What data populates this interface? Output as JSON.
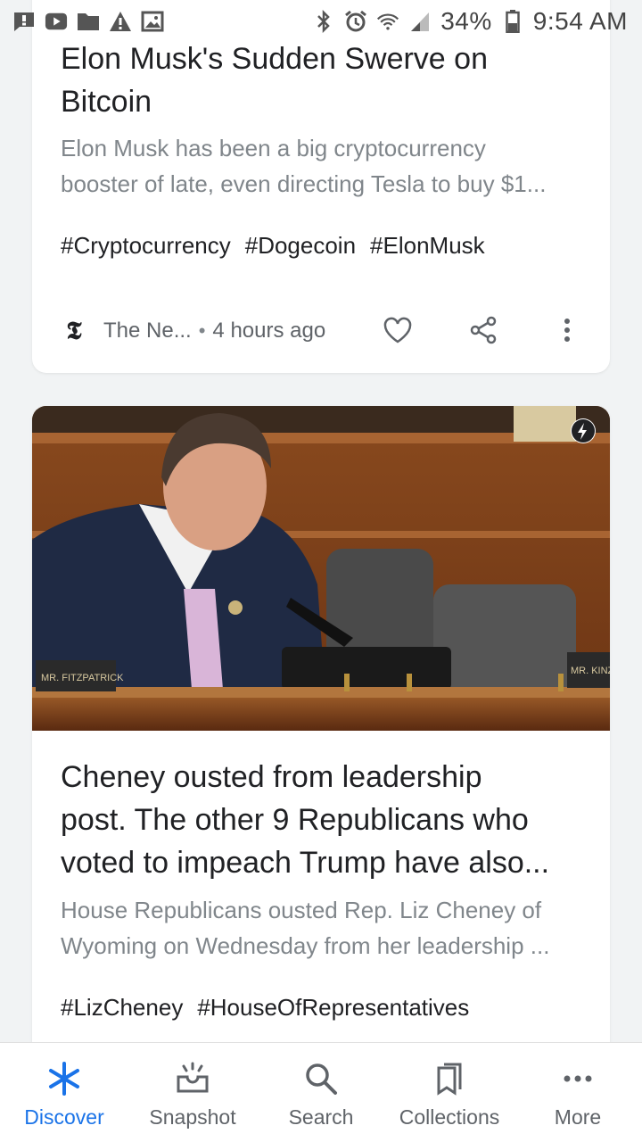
{
  "status_bar": {
    "battery": "34%",
    "time": "9:54 AM",
    "left_icons": [
      "message-icon",
      "youtube-icon",
      "folder-icon",
      "warning-icon",
      "image-icon"
    ],
    "right_icons": [
      "bluetooth-icon",
      "alarm-icon",
      "wifi-icon",
      "signal-icon",
      "battery-icon"
    ]
  },
  "card1": {
    "headline": [
      "Elon Musk's Sudden Swerve on",
      "Bitcoin"
    ],
    "snippet": [
      "Elon Musk has been a big cryptocurrency",
      "booster of late, even directing Tesla to buy $1..."
    ],
    "tags": [
      "#Cryptocurrency",
      "#Dogecoin",
      "#ElonMusk"
    ],
    "source_logo": "𝕿",
    "source": "The Ne...",
    "separator": "•",
    "time": "4 hours ago"
  },
  "card2": {
    "headline": [
      "Cheney ousted from leadership",
      "post. The other 9 Republicans who",
      "voted to impeach Trump have also..."
    ],
    "snippet": [
      "House Republicans ousted Rep. Liz Cheney of",
      "Wyoming on Wednesday from her leadership ..."
    ],
    "tags": [
      "#LizCheney",
      "#HouseOfRepresentatives"
    ],
    "placard_right": "MR. KINZ",
    "placard_left": "MR. FITZPATRICK"
  },
  "nav": {
    "items": [
      {
        "label": "Discover",
        "icon": "asterisk-icon",
        "active": true
      },
      {
        "label": "Snapshot",
        "icon": "snapshot-icon",
        "active": false
      },
      {
        "label": "Search",
        "icon": "search-icon",
        "active": false
      },
      {
        "label": "Collections",
        "icon": "collections-icon",
        "active": false
      },
      {
        "label": "More",
        "icon": "more-icon",
        "active": false
      }
    ]
  },
  "colors": {
    "accent": "#1a73e8",
    "background": "#f1f3f4",
    "card": "#ffffff",
    "secondary_text": "#80868b"
  }
}
